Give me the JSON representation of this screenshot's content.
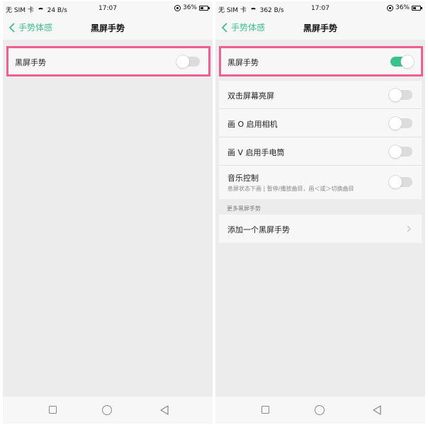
{
  "status_bar": {
    "left_screen": {
      "carrier": "无 SIM 卡",
      "speed": "24 B/s",
      "time": "17:07",
      "battery": "36%"
    },
    "right_screen": {
      "carrier": "无 SIM 卡",
      "speed": "362 B/s",
      "time": "17:07",
      "battery": "36%"
    },
    "battery_level_fraction": 0.36
  },
  "header": {
    "back_label": "手势体感",
    "title": "黑屏手势"
  },
  "left_screen": {
    "main_toggle": {
      "label": "黑屏手势",
      "on": false
    }
  },
  "right_screen": {
    "main_toggle": {
      "label": "黑屏手势",
      "on": true
    },
    "gestures": [
      {
        "label": "双击屏幕亮屏",
        "on": false
      },
      {
        "label": "画 O 启用相机",
        "on": false
      },
      {
        "label": "画 V 启用手电筒",
        "on": false
      },
      {
        "label": "音乐控制",
        "description": "息屏状态下画 | 暂停/播放曲目，画＜或＞切换曲目",
        "on": false
      }
    ],
    "more_section_title": "更多黑屏手势",
    "add_gesture_label": "添加一个黑屏手势"
  },
  "colors": {
    "accent": "#39c48e",
    "highlight": "#ef5f93",
    "toggle_off": "#dcdcdc",
    "background": "#ececec"
  },
  "icons": {
    "back": "chevron-left-icon",
    "wifi": "wifi-icon",
    "rotation_lock": "rotation-lock-icon",
    "battery": "battery-icon",
    "row_arrow": "chevron-right-icon",
    "nav_recent": "recent-apps-icon",
    "nav_home": "home-icon",
    "nav_back": "nav-back-icon"
  }
}
